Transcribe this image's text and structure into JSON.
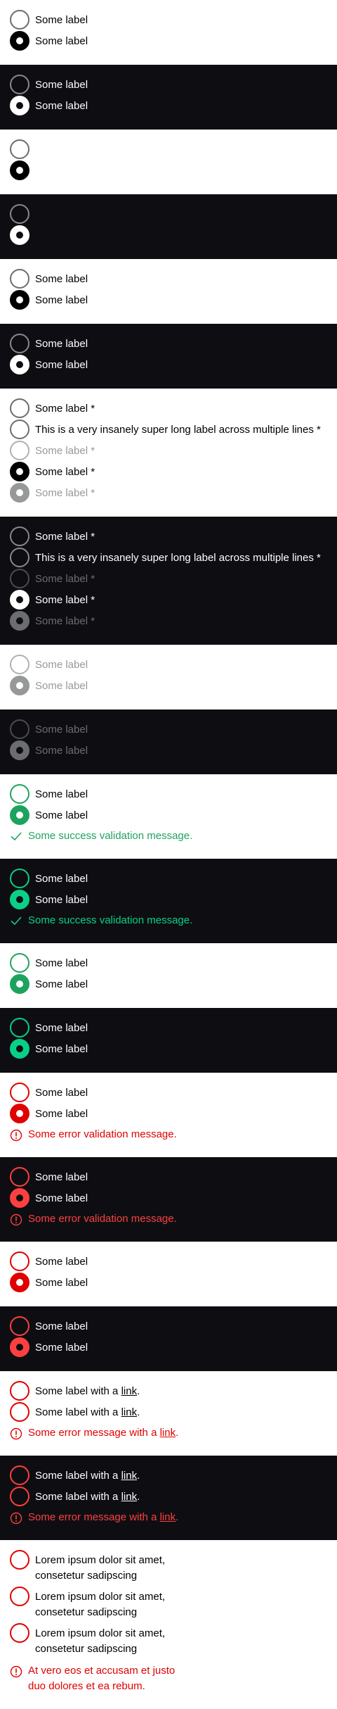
{
  "colors": {
    "light_bg": "#ffffff",
    "dark_bg": "#0e0e12",
    "success_light": "#1ea35e",
    "success_dark": "#09d087",
    "error_light": "#e00000",
    "error_dark": "#fc4040",
    "disabled_light": "#96989a",
    "disabled_dark": "#6b6d70"
  },
  "labels": {
    "some_label": "Some label",
    "some_label_req": "Some label *",
    "long_label_req": "This is a very insanely super long label across multiple lines *",
    "label_with_link_prefix": "Some label with a ",
    "link": "link",
    "period": ".",
    "lorem": "Lorem ipsum dolor sit amet, consetetur sadipscing"
  },
  "messages": {
    "success": "Some success validation message.",
    "error": "Some error validation message.",
    "error_link_prefix": "Some error message with a ",
    "error_long": "At vero eos et accusam et justo duo dolores et ea rebum."
  },
  "icons": {
    "success": "check-icon",
    "error": "exclamation-circle-icon"
  }
}
